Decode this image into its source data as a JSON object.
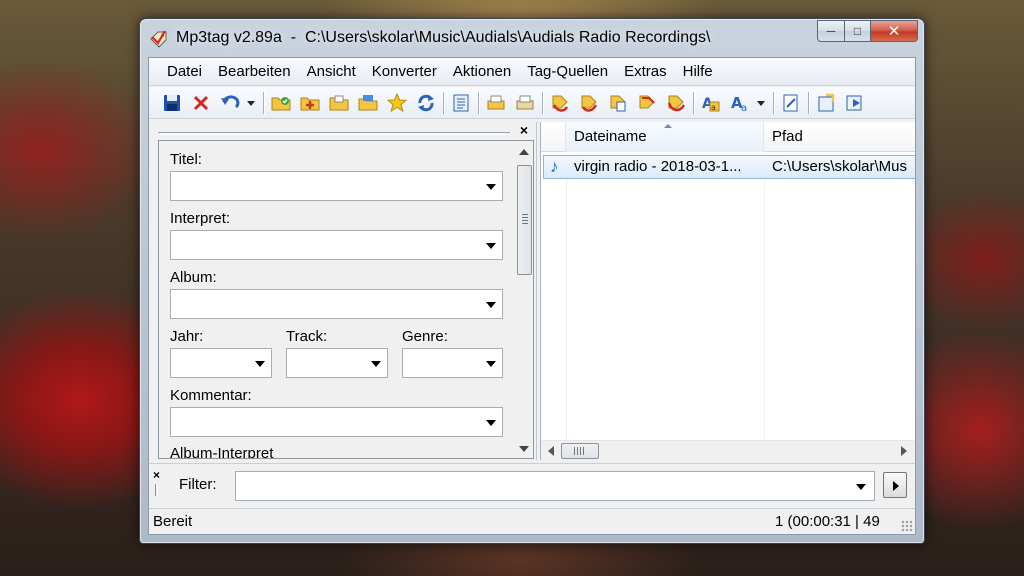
{
  "window": {
    "title": "Mp3tag v2.89a  -  C:\\Users\\skolar\\Music\\Audials\\Audials Radio Recordings\\",
    "controls": {
      "minimize": "─",
      "maximize": "□",
      "close": "✕"
    }
  },
  "menu": [
    "Datei",
    "Bearbeiten",
    "Ansicht",
    "Konverter",
    "Aktionen",
    "Tag-Quellen",
    "Extras",
    "Hilfe"
  ],
  "toolbar": {
    "icons": [
      "save-icon",
      "remove-tag-icon",
      "undo-icon",
      "change-directory-icon",
      "add-directory-icon",
      "open-folder-icon",
      "playlist-icon",
      "favorite-icon",
      "refresh-icon",
      "extended-tags-icon",
      "print-icon",
      "export-icon",
      "tag-filename-icon",
      "filename-tag-icon",
      "text-file-tag-icon",
      "tag-tag-icon",
      "autonumber-icon",
      "case-conversion-icon",
      "replace-icon",
      "options-icon",
      "web-sources-icon",
      "next-icon"
    ]
  },
  "tag_panel": {
    "close": "×",
    "fields": {
      "titel": {
        "label": "Titel:",
        "value": ""
      },
      "interpret": {
        "label": "Interpret:",
        "value": ""
      },
      "album": {
        "label": "Album:",
        "value": ""
      },
      "jahr": {
        "label": "Jahr:",
        "value": ""
      },
      "track": {
        "label": "Track:",
        "value": ""
      },
      "genre": {
        "label": "Genre:",
        "value": ""
      },
      "kommentar": {
        "label": "Kommentar:",
        "value": ""
      },
      "album_interpret": {
        "label": "Album-Interpret",
        "value": ""
      }
    }
  },
  "file_list": {
    "columns": [
      "Dateiname",
      "Pfad"
    ],
    "rows": [
      {
        "filename": "virgin radio - 2018-03-1...",
        "path": "C:\\Users\\skolar\\Mus"
      }
    ]
  },
  "filter": {
    "label": "Filter:",
    "value": "",
    "close": "×"
  },
  "status": {
    "left": "Bereit",
    "right": "1 (00:00:31 | 49"
  },
  "colors": {
    "accent": "#2a6cc2",
    "selection": "#dcebfb",
    "close_button": "#c23a22"
  }
}
